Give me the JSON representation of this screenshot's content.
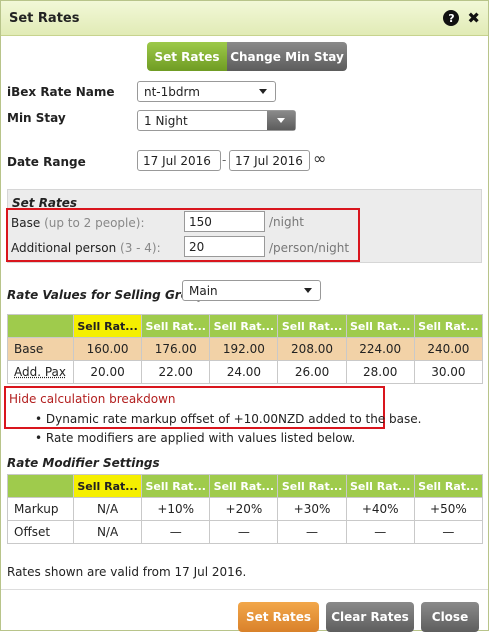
{
  "dialog": {
    "title": "Set Rates",
    "help_icon": "?",
    "close_icon": "✖"
  },
  "tabs": [
    {
      "label": "Set Rates",
      "active": true
    },
    {
      "label": "Change Min Stay",
      "active": false
    }
  ],
  "form": {
    "rate_name_label": "iBex Rate Name",
    "rate_name_value": "nt-1bdrm",
    "min_stay_label": "Min Stay",
    "min_stay_value": "1 Night",
    "date_range_label": "Date Range",
    "date_from": "17 Jul 2016",
    "date_sep": "-",
    "date_to": "17 Jul 2016",
    "infinity": "∞"
  },
  "set_rates": {
    "title": "Set Rates",
    "base_label": "Base",
    "base_hint": "(up to 2 people):",
    "base_value": "150",
    "base_unit": "/night",
    "addl_label": "Additional person",
    "addl_hint": "(3 - 4):",
    "addl_value": "20",
    "addl_unit": "/person/night"
  },
  "selling_group": {
    "label": "Rate Values for Selling Group:",
    "value": "Main"
  },
  "rate_table": {
    "headers": [
      "Sell Rat...",
      "Sell Rat...",
      "Sell Rat...",
      "Sell Rat...",
      "Sell Rat...",
      "Sell Rat..."
    ],
    "rows": [
      {
        "label": "Base",
        "values": [
          "160.00",
          "176.00",
          "192.00",
          "208.00",
          "224.00",
          "240.00"
        ]
      },
      {
        "label": "Add. Pax",
        "values": [
          "20.00",
          "22.00",
          "24.00",
          "26.00",
          "28.00",
          "30.00"
        ]
      }
    ]
  },
  "breakdown": {
    "toggle_label": "Hide calculation breakdown",
    "line1": "Dynamic rate markup offset of +10.00NZD added to the base.",
    "line2": "Rate modifiers are applied with values listed below."
  },
  "modifier": {
    "title": "Rate Modifier Settings",
    "headers": [
      "Sell Rat...",
      "Sell Rat...",
      "Sell Rat...",
      "Sell Rat...",
      "Sell Rat...",
      "Sell Rat..."
    ],
    "rows": [
      {
        "label": "Markup",
        "values": [
          "N/A",
          "+10%",
          "+20%",
          "+30%",
          "+40%",
          "+50%"
        ]
      },
      {
        "label": "Offset",
        "values": [
          "N/A",
          "—",
          "—",
          "—",
          "—",
          "—"
        ]
      }
    ]
  },
  "valid_note": "Rates shown are valid from 17 Jul 2016.",
  "buttons": {
    "set_rates": "Set Rates",
    "clear_rates": "Clear Rates",
    "close": "Close"
  },
  "colors": {
    "accent_green": "#9fcb4c",
    "highlight_yellow": "#f5ef00",
    "orange_row": "#f2d2a7",
    "red_outline": "#d9151d",
    "orange_button": "#e18f33"
  }
}
